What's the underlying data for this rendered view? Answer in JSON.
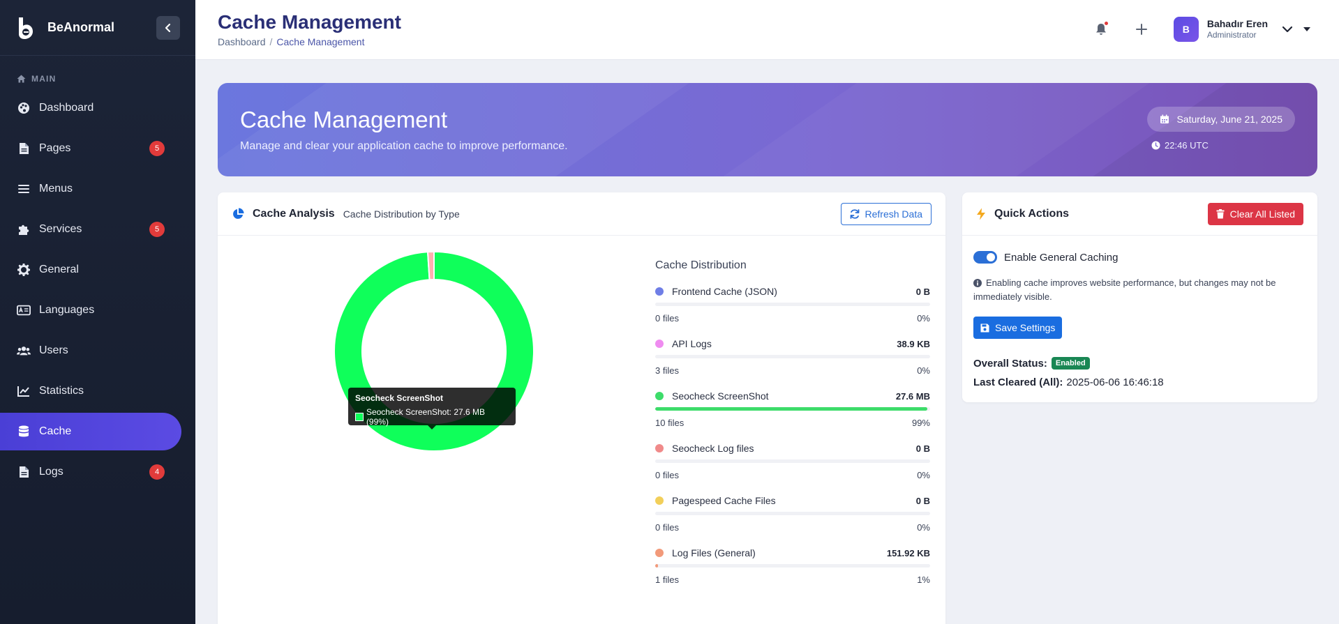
{
  "brand": {
    "name": "BeAnormal"
  },
  "sidebar": {
    "section_label": "MAIN",
    "items": [
      {
        "label": "Dashboard",
        "icon": "palette-icon",
        "badge": null
      },
      {
        "label": "Pages",
        "icon": "file-icon",
        "badge": "5"
      },
      {
        "label": "Menus",
        "icon": "bars-icon",
        "badge": null
      },
      {
        "label": "Services",
        "icon": "puzzle-icon",
        "badge": "5"
      },
      {
        "label": "General",
        "icon": "gear-icon",
        "badge": null
      },
      {
        "label": "Languages",
        "icon": "language-icon",
        "badge": null
      },
      {
        "label": "Users",
        "icon": "users-icon",
        "badge": null
      },
      {
        "label": "Statistics",
        "icon": "chart-line-icon",
        "badge": null
      },
      {
        "label": "Cache",
        "icon": "database-icon",
        "badge": null
      },
      {
        "label": "Logs",
        "icon": "file-icon",
        "badge": "4"
      }
    ],
    "active_index": 8
  },
  "header": {
    "title": "Cache Management",
    "breadcrumb": {
      "home": "Dashboard",
      "separator": "/",
      "current": "Cache Management"
    },
    "user": {
      "initial": "B",
      "name": "Bahadır Eren",
      "role": "Administrator"
    }
  },
  "hero": {
    "title": "Cache Management",
    "subtitle": "Manage and clear your application cache to improve performance.",
    "date": "Saturday, June 21, 2025",
    "time": "22:46 UTC"
  },
  "analysis": {
    "title": "Cache Analysis",
    "subtitle": "Cache Distribution by Type",
    "refresh_label": "Refresh Data",
    "tooltip": {
      "title": "Seocheck ScreenShot",
      "line": "Seocheck ScreenShot: 27.6 MB (99%)"
    },
    "distribution_title": "Cache Distribution",
    "items": [
      {
        "name": "Frontend Cache (JSON)",
        "size": "0 B",
        "files": "0 files",
        "percent": "0%",
        "fraction": 0,
        "color": "#6f7ee6"
      },
      {
        "name": "API Logs",
        "size": "38.9 KB",
        "files": "3 files",
        "percent": "0%",
        "fraction": 0,
        "color": "#ef8cf0"
      },
      {
        "name": "Seocheck ScreenShot",
        "size": "27.6 MB",
        "files": "10 files",
        "percent": "99%",
        "fraction": 0.99,
        "color": "#3ddc6a"
      },
      {
        "name": "Seocheck Log files",
        "size": "0 B",
        "files": "0 files",
        "percent": "0%",
        "fraction": 0,
        "color": "#f08a8a"
      },
      {
        "name": "Pagespeed Cache Files",
        "size": "0 B",
        "files": "0 files",
        "percent": "0%",
        "fraction": 0,
        "color": "#f2cf5a"
      },
      {
        "name": "Log Files (General)",
        "size": "151.92 KB",
        "files": "1 files",
        "percent": "1%",
        "fraction": 0.01,
        "color": "#f29a7a"
      }
    ]
  },
  "chart_data": {
    "type": "pie",
    "categories": [
      "Frontend Cache (JSON)",
      "API Logs",
      "Seocheck ScreenShot",
      "Seocheck Log files",
      "Pagespeed Cache Files",
      "Log Files (General)"
    ],
    "values": [
      0,
      0,
      99,
      0,
      0,
      1
    ],
    "colors": [
      "#6f7ee6",
      "#ef8cf0",
      "#0fff5a",
      "#f08a8a",
      "#f2cf5a",
      "#ffb0b0"
    ],
    "donut": true
  },
  "actions": {
    "title": "Quick Actions",
    "clear_label": "Clear All Listed",
    "toggle_label": "Enable General Caching",
    "toggle_on": true,
    "info": "Enabling cache improves website performance, but changes may not be immediately visible.",
    "save_label": "Save Settings",
    "status_label": "Overall Status:",
    "status_value": "Enabled",
    "cleared_label": "Last Cleared (All):",
    "cleared_value": "2025-06-06 16:46:18"
  }
}
